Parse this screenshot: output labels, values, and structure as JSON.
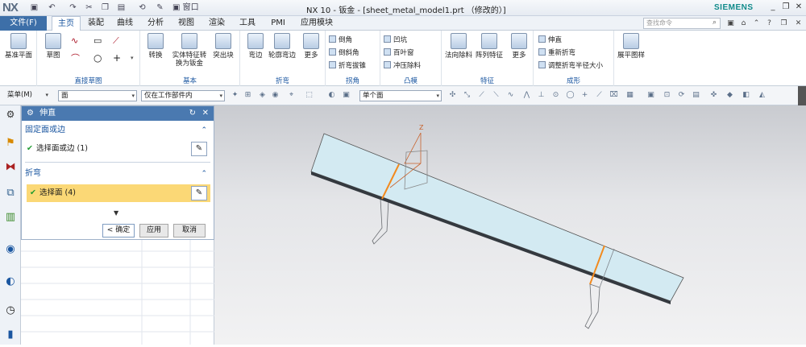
{
  "app": {
    "logo": "NX",
    "window_title": "NX 10 - 钣金 - [sheet_metal_model1.prt （修改的）]",
    "brand": "SIEMENS",
    "quick_access": {
      "window_label": "窗口"
    }
  },
  "menubar": {
    "file_label": "文件(F)",
    "tabs": [
      "主页",
      "装配",
      "曲线",
      "分析",
      "视图",
      "渲染",
      "工具",
      "PMI",
      "应用模块"
    ],
    "active_tab": "主页",
    "search_placeholder": "查找命令"
  },
  "ribbon": {
    "groups": [
      {
        "title": "",
        "buttons": [
          "基准平面"
        ]
      },
      {
        "title": "直接草图",
        "buttons": [
          "草图"
        ]
      },
      {
        "title": "基本",
        "buttons": [
          "转换",
          "实体特征转换为钣金",
          "突出块"
        ]
      },
      {
        "title": "折弯",
        "buttons": [
          "弯边",
          "轮廓弯边",
          "更多"
        ]
      },
      {
        "title": "拐角",
        "small": [
          "倒角",
          "倒斜角",
          "折弯拔锥"
        ]
      },
      {
        "title": "凸模",
        "small": [
          "凹坑",
          "百叶窗",
          "冲压除料"
        ]
      },
      {
        "title": "特征",
        "buttons": [
          "法向除料",
          "阵列特征",
          "更多"
        ]
      },
      {
        "title": "成形",
        "small": [
          "伸直",
          "重新折弯",
          "调整折弯半径大小"
        ]
      },
      {
        "title": "",
        "buttons": [
          "展平图样"
        ]
      }
    ]
  },
  "toolbar2": {
    "menu_label": "菜单(M)",
    "filter_type": "面",
    "filter_scope": "仅在工作部件内",
    "select_mode": "单个面"
  },
  "dialog": {
    "title": "伸直",
    "section1": {
      "title": "固定面或边",
      "row": "选择面或边 (1)"
    },
    "section2": {
      "title": "折弯",
      "row": "选择面 (4)"
    },
    "buttons": {
      "ok": "< 确定 >",
      "apply": "应用",
      "cancel": "取消"
    }
  },
  "viewport": {
    "axis_label": "Z"
  },
  "colors": {
    "accent": "#3d6fa8",
    "selection": "#fbd876",
    "highlight": "#f28a1e",
    "part": "#d3eaf2"
  }
}
